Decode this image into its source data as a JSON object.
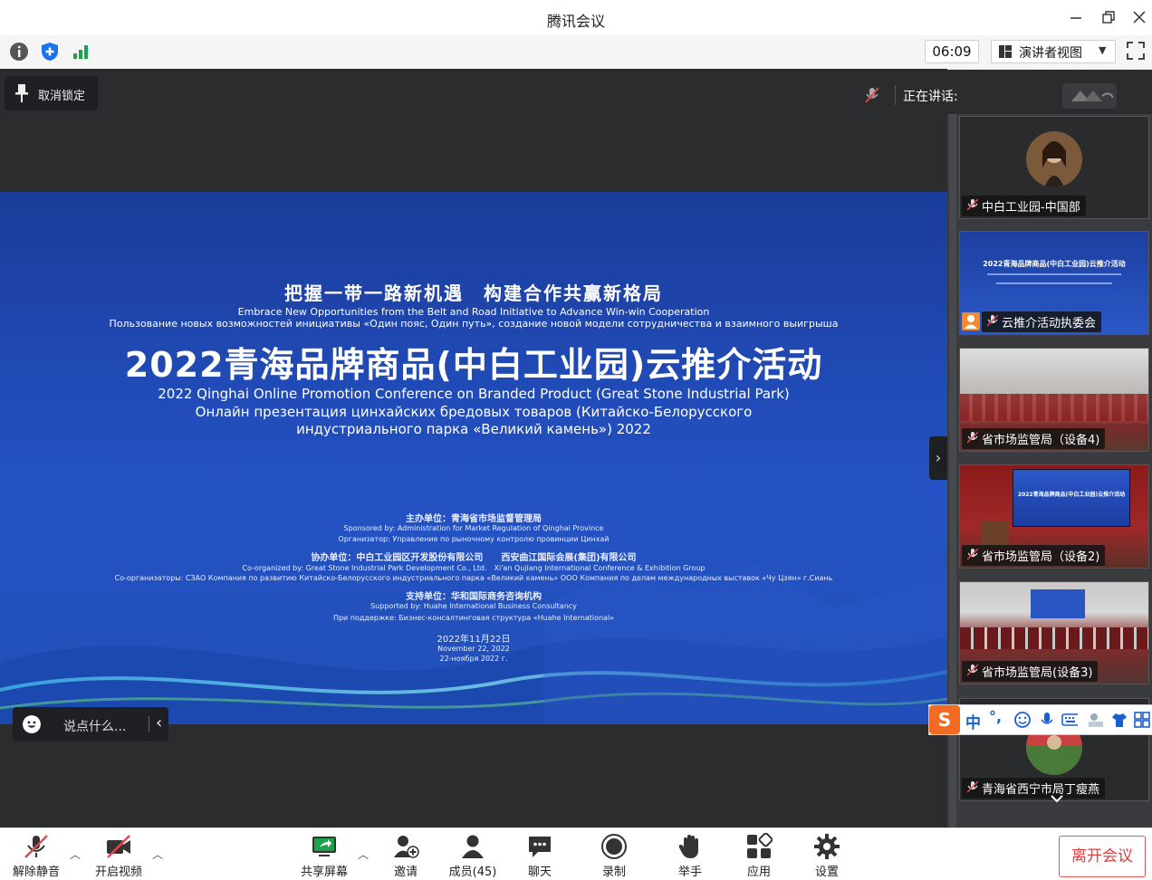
{
  "window": {
    "title": "腾讯会议"
  },
  "toolbar": {
    "timer": "06:09",
    "view_mode": "演讲者视图"
  },
  "main": {
    "unpin_label": "取消锁定",
    "chat_placeholder": "说点什么...",
    "speaking_label": "正在讲话:"
  },
  "slide": {
    "cn_slogan": "把握一带一路新机遇　构建合作共赢新格局",
    "en_slogan": "Embrace New Opportunities from the Belt and Road Initiative to Advance Win-win Cooperation",
    "ru_slogan": "Пользование новых возможностей инициативы «Один пояс, Один путь», создание новой модели сотрудничества и взаимного выигрыша",
    "title": "2022青海品牌商品(中白工业园)云推介活动",
    "en_title": "2022 Qinghai Online Promotion Conference on Branded Product (Great Stone Industrial Park)",
    "ru_title_line1": "Онлайн презентация цинхайских бредовых товаров (Китайско-Белорусского",
    "ru_title_line2": "индустриального парка «Великий камень») 2022",
    "host": "主办单位：青海省市场监督管理局",
    "host_en": "Sponsored by: Administration for Market Regulation of Qinghai Province",
    "host_ru": "Организатор: Управление по рыночному контролю провинции Цинхай",
    "co": "协办单位：中白工业园区开发股份有限公司　　西安曲江国际会展(集团)有限公司",
    "co_en": "Co-organized by: Great Stone Industrial Park Development Co., Ltd.　Xi'an Qujiang International Conference & Exhibition Group",
    "co_ru": "Со-организаторы: СЗАО Компания по развитию Китайско-Белорусского индустриального парка «Великий камень» ООО Компания по делам международных выставок «Чу Цзян» г.Сиань",
    "sup": "支持单位：华和国际商务咨询机构",
    "sup_en": "Supported by: Huahe International Business Consultancy",
    "sup_ru": "При поддержке: Бизнес-консалтинговая структура «Huahe International»",
    "date": "2022年11月22日",
    "date_en": "November 22, 2022",
    "date_ru": "22-ноября 2022 г."
  },
  "participants": [
    {
      "name": "中白工业园-中国部"
    },
    {
      "name": "云推介活动执委会",
      "thumb_title": "2022青海品牌商品(中白工业园)云推介活动"
    },
    {
      "name": "省市场监管局（设备4)"
    },
    {
      "name": "省市场监管局（设备2)",
      "thumb_title": "2022青海品牌商品(中白工业园)云推介活动"
    },
    {
      "name": "省市场监管局(设备3)"
    },
    {
      "name": "青海省西宁市局丁瘦燕"
    }
  ],
  "ime": {
    "mode": "中",
    "punct": "°,"
  },
  "bottom": {
    "unmute": "解除静音",
    "video": "开启视频",
    "share": "共享屏幕",
    "invite": "邀请",
    "members": "成员(45)",
    "chat": "聊天",
    "record": "录制",
    "raise_hand": "举手",
    "apps": "应用",
    "settings": "设置",
    "leave": "离开会议"
  },
  "colors": {
    "slide_blue": "#2452c4",
    "leave_red": "#e23c3c",
    "share_green": "#1aa34a",
    "ime_orange": "#f36b23"
  }
}
